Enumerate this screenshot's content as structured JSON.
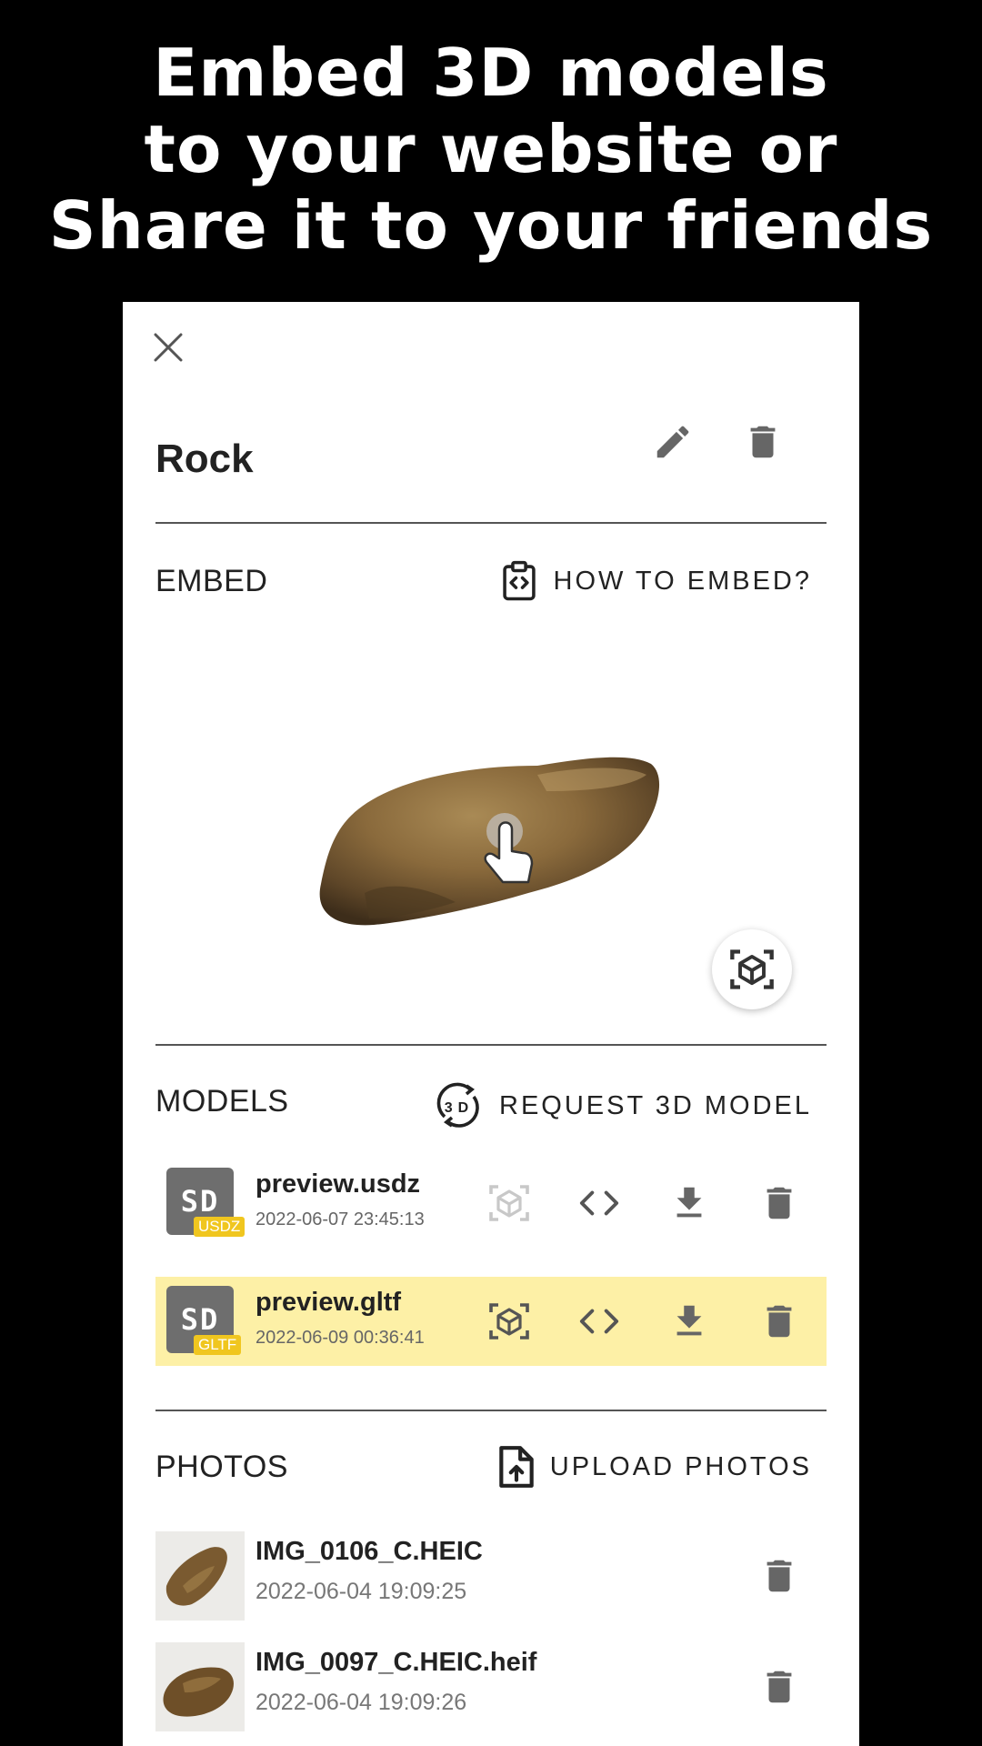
{
  "headline": {
    "line1": "Embed 3D models",
    "line2": "to your website or",
    "line3": "Share it to your friends"
  },
  "dialog": {
    "close_icon": "close-icon",
    "title": "Rock",
    "edit_icon": "pencil-icon",
    "delete_icon": "trash-icon"
  },
  "embed": {
    "label": "EMBED",
    "action": "HOW TO EMBED?",
    "action_icon": "code-clipboard-icon",
    "ar_icon": "ar-cube-icon"
  },
  "models": {
    "label": "MODELS",
    "action": "REQUEST 3D MODEL",
    "action_icon": "3d-rotate-icon",
    "items": [
      {
        "thumb": "SD",
        "badge": "USDZ",
        "name": "preview.usdz",
        "date": "2022-06-07 23:45:13",
        "active": false
      },
      {
        "thumb": "SD",
        "badge": "GLTF",
        "name": "preview.gltf",
        "date": "2022-06-09 00:36:41",
        "active": true
      }
    ]
  },
  "photos": {
    "label": "PHOTOS",
    "action": "UPLOAD PHOTOS",
    "action_icon": "file-upload-icon",
    "items": [
      {
        "name": "IMG_0106_C.HEIC",
        "date": "2022-06-04 19:09:25"
      },
      {
        "name": "IMG_0097_C.HEIC.heif",
        "date": "2022-06-04 19:09:26"
      }
    ]
  },
  "colors": {
    "highlight_row": "#fdf0a6",
    "badge": "#f0c61f",
    "icon_gray": "#666666"
  }
}
